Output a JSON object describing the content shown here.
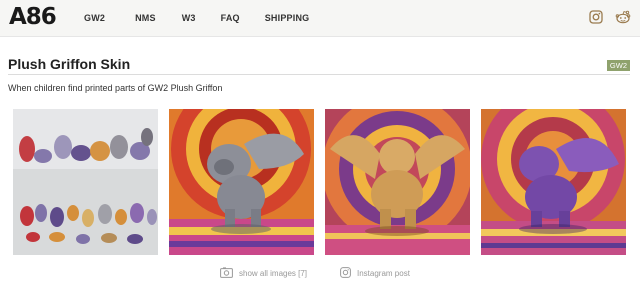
{
  "header": {
    "logo": "A86",
    "nav": [
      "GW2",
      "NMS",
      "W3",
      "FAQ",
      "SHIPPING"
    ],
    "social_icons": [
      "instagram-icon",
      "reddit-icon"
    ]
  },
  "page": {
    "title": "Plush Griffon Skin",
    "tag": "GW2",
    "description": "When children find printed parts of GW2 Plush Griffon"
  },
  "gallery": {
    "images": [
      {
        "subject": "colorful printed parts laid out",
        "accent": "#b05a8f"
      },
      {
        "subject": "gray griffon figure on patterned rug",
        "accent": "#8c8c90"
      },
      {
        "subject": "gold griffon figure on patterned rug",
        "accent": "#d6a662"
      },
      {
        "subject": "purple griffon figure on patterned rug",
        "accent": "#7b4fa8"
      }
    ]
  },
  "footer": {
    "show_all": "show all images [7]",
    "instagram": "Instagram post"
  },
  "colors": {
    "accent": "#9a7b4f",
    "tag_bg": "#8fa26d"
  }
}
